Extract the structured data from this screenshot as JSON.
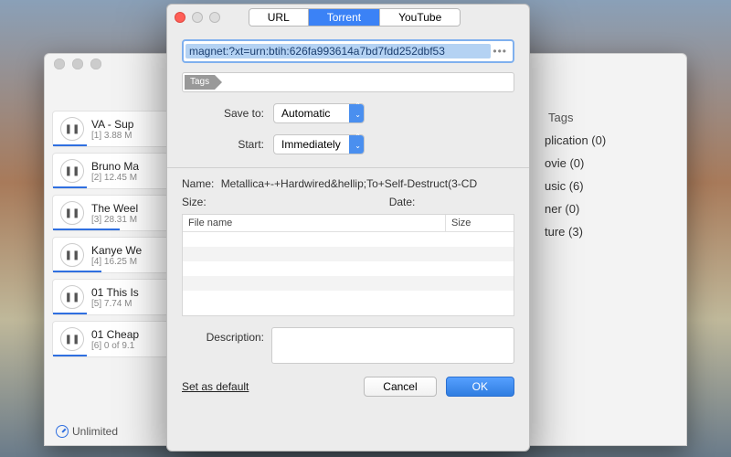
{
  "main": {
    "downloads": [
      {
        "title": "VA - Sup",
        "index": "[1]",
        "size": "3.88 M"
      },
      {
        "title": "Bruno Ma",
        "index": "[2]",
        "size": "12.45 M"
      },
      {
        "title": "The Weel",
        "index": "[3]",
        "size": "28.31 M"
      },
      {
        "title": "Kanye We",
        "index": "[4]",
        "size": "16.25 M"
      },
      {
        "title": "01 This Is",
        "index": "[5]",
        "size": "7.74 M"
      },
      {
        "title": "01 Cheap",
        "index": "[6]",
        "size": "0 of 9.1"
      }
    ],
    "footer": "Unlimited",
    "tags_header": "Tags",
    "tags": [
      "plication (0)",
      "ovie (0)",
      "usic (6)",
      "ner (0)",
      "ture (3)"
    ]
  },
  "dialog": {
    "tabs": {
      "url": "URL",
      "torrent": "Torrent",
      "youtube": "YouTube"
    },
    "url_value": "magnet:?xt=urn:btih:626fa993614a7bd7fdd252dbf53",
    "tags_chip": "Tags",
    "save_to_label": "Save to:",
    "save_to_value": "Automatic",
    "start_label": "Start:",
    "start_value": "Immediately",
    "name_label": "Name:",
    "name_value": "Metallica+-+Hardwired&hellip;To+Self-Destruct(3-CD",
    "size_label": "Size:",
    "date_label": "Date:",
    "table": {
      "col_filename": "File name",
      "col_size": "Size"
    },
    "description_label": "Description:",
    "set_default": "Set as default",
    "cancel": "Cancel",
    "ok": "OK"
  }
}
